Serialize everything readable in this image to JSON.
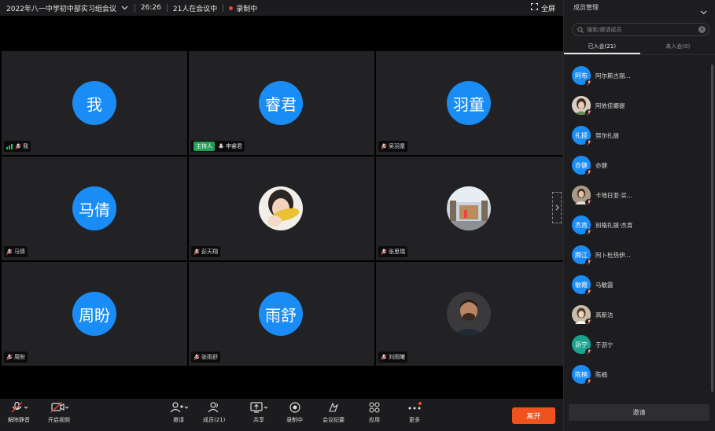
{
  "topbar": {
    "meeting_title": "2022年八一中学初中部实习组会议",
    "duration": "26:26",
    "participants_status": "21人在会议中",
    "recording_status": "录制中",
    "fullscreen_label": "全屏"
  },
  "grid": {
    "tiles": [
      {
        "avatar_text": "我",
        "name": "我",
        "type": "avatar"
      },
      {
        "avatar_text": "睿君",
        "name": "申睿君",
        "type": "avatar",
        "host_label": "主持人"
      },
      {
        "avatar_text": "羽童",
        "name": "吴羽童",
        "type": "avatar"
      },
      {
        "avatar_text": "马倩",
        "name": "马倩",
        "type": "avatar"
      },
      {
        "name": "彭天翔",
        "type": "photo"
      },
      {
        "name": "张思瑞",
        "type": "photo"
      },
      {
        "avatar_text": "周盼",
        "name": "周盼",
        "type": "avatar"
      },
      {
        "avatar_text": "雨舒",
        "name": "张雨舒",
        "type": "avatar"
      },
      {
        "name": "刘雨曦",
        "type": "photo"
      }
    ]
  },
  "toolbar": {
    "mute_label": "解除静音",
    "camera_label": "开启视频",
    "invite_label": "邀请",
    "members_label": "成员(21)",
    "share_label": "共享",
    "record_label": "录制中",
    "minutes_label": "会议纪要",
    "apps_label": "应用",
    "more_label": "更多",
    "leave_label": "离开"
  },
  "panel": {
    "title": "成员管理",
    "search_placeholder": "搜索/邀请成员",
    "tab_joined": "已入会(21)",
    "tab_not_joined": "未入会(0)",
    "members": [
      {
        "avatar_text": "阿布",
        "name": "阿尔斯古丽...",
        "type": "avatar"
      },
      {
        "name": "阿依佳娜提",
        "type": "photo"
      },
      {
        "avatar_text": "扎提",
        "name": "努尔扎提",
        "type": "avatar"
      },
      {
        "avatar_text": "亦健",
        "name": "亦健",
        "type": "avatar"
      },
      {
        "name": "卡地日亚·买...",
        "type": "photo"
      },
      {
        "avatar_text": "杰肯",
        "name": "别格扎提·杰肯",
        "type": "avatar"
      },
      {
        "avatar_text": "腾江",
        "name": "阿卜杜热伊...",
        "type": "avatar"
      },
      {
        "avatar_text": "敏霞",
        "name": "马敏霞",
        "type": "avatar"
      },
      {
        "name": "高新洁",
        "type": "photo"
      },
      {
        "avatar_text": "沥宁",
        "name": "于沥宁",
        "type": "avatar"
      },
      {
        "avatar_text": "陈楠",
        "name": "陈楠",
        "type": "avatar"
      }
    ],
    "invite_button": "邀请"
  },
  "colors": {
    "avatar_blue": "#1a8cf5",
    "leave_orange": "#f0521e",
    "host_green": "#22a056",
    "record_red": "#e8453c"
  }
}
